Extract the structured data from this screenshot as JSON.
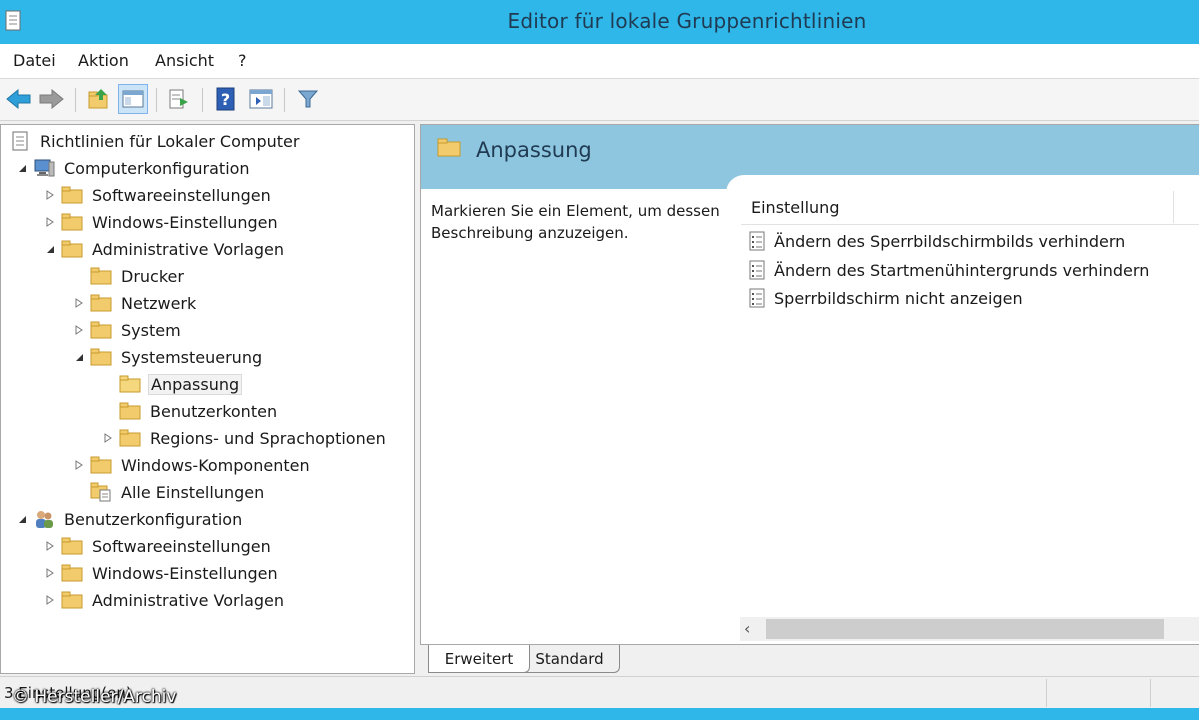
{
  "window": {
    "title": "Editor für lokale Gruppenrichtlinien"
  },
  "menu": {
    "items": [
      "Datei",
      "Aktion",
      "Ansicht",
      "?"
    ]
  },
  "toolbar": {
    "buttons": [
      "back-arrow-icon",
      "forward-arrow-icon",
      "up-folder-icon",
      "show-hide-tree-icon",
      "export-list-icon",
      "help-icon",
      "properties-pane-icon",
      "filter-icon"
    ]
  },
  "tree": {
    "items": [
      {
        "label": "Richtlinien für Lokaler Computer"
      },
      {
        "label": "Computerkonfiguration"
      },
      {
        "label": "Softwareeinstellungen"
      },
      {
        "label": "Windows-Einstellungen"
      },
      {
        "label": "Administrative Vorlagen"
      },
      {
        "label": "Drucker"
      },
      {
        "label": "Netzwerk"
      },
      {
        "label": "System"
      },
      {
        "label": "Systemsteuerung"
      },
      {
        "label": "Anpassung"
      },
      {
        "label": "Benutzerkonten"
      },
      {
        "label": "Regions- und Sprachoptionen"
      },
      {
        "label": "Windows-Komponenten"
      },
      {
        "label": "Alle Einstellungen"
      },
      {
        "label": "Benutzerkonfiguration"
      },
      {
        "label": "Softwareeinstellungen"
      },
      {
        "label": "Windows-Einstellungen"
      },
      {
        "label": "Administrative Vorlagen"
      }
    ]
  },
  "details": {
    "title": "Anpassung",
    "description": "Markieren Sie ein Element, um dessen Beschreibung anzuzeigen.",
    "column_header": "Einstellung",
    "settings": [
      "Ändern des Sperrbildschirmbilds verhindern",
      "Ändern des Startmenühintergrunds verhindern",
      "Sperrbildschirm nicht anzeigen"
    ]
  },
  "tabs": {
    "extended": "Erweitert",
    "standard": "Standard"
  },
  "status": {
    "text": "3 Einstellung(en)"
  },
  "watermark": "© Hersteller/Archiv",
  "colors": {
    "titlebar": "#2eb7e8",
    "banner": "#8ec6e0",
    "folder": "#f2cc6c"
  }
}
